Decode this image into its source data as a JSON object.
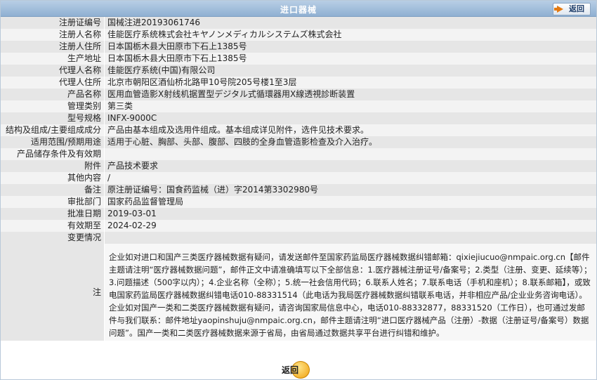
{
  "header": {
    "title": "进口器械",
    "back_label": "返回"
  },
  "rows": [
    {
      "label": "注册证编号",
      "value": "国械注进20193061746"
    },
    {
      "label": "注册人名称",
      "value": "佳能医疗系统株式会社キヤノンメディカルシステムズ株式会社"
    },
    {
      "label": "注册人住所",
      "value": "日本国栃木县大田原市下石上1385号"
    },
    {
      "label": "生产地址",
      "value": "日本国栃木县大田原市下石上1385号"
    },
    {
      "label": "代理人名称",
      "value": "佳能医疗系统(中国)有限公司"
    },
    {
      "label": "代理人住所",
      "value": "北京市朝阳区酒仙桥北路甲10号院205号楼1至3层"
    },
    {
      "label": "产品名称",
      "value": "医用血管造影X射线机据置型デジタル式循環器用X線透視診断装置"
    },
    {
      "label": "管理类别",
      "value": "第三类"
    },
    {
      "label": "型号规格",
      "value": "INFX-9000C"
    },
    {
      "label": "结构及组成/主要组成成分",
      "value": "产品由基本组成及选用件组成。基本组成详见附件，选件见技术要求。"
    },
    {
      "label": "适用范围/预期用途",
      "value": "适用于心脏、胸部、头部、腹部、四肢的全身血管造影检查及介入治疗。"
    },
    {
      "label": "产品储存条件及有效期",
      "value": ""
    },
    {
      "label": "附件",
      "value": "产品技术要求"
    },
    {
      "label": "其他内容",
      "value": "/"
    },
    {
      "label": "备注",
      "value": "原注册证编号：国食药监械（进）字2014第3302980号"
    },
    {
      "label": "审批部门",
      "value": "国家药品监督管理局"
    },
    {
      "label": "批准日期",
      "value": "2019-03-01"
    },
    {
      "label": "有效期至",
      "value": "2024-02-29"
    },
    {
      "label": "变更情况",
      "value": ""
    }
  ],
  "note": {
    "label": "注",
    "text": "企业如对进口和国产三类医疗器械数据有疑问，请发送邮件至国家药监局医疗器械数据纠错邮箱：qixiejiucuo@nmpaic.org.cn【邮件主题请注明“医疗器械数据问题”，邮件正文中请准确填写以下全部信息：1.医疗器械注册证号/备案号；2.类型（注册、变更、延续等）；3.问题描述（500字以内）；4.企业名称（全称）；5.统一社会信用代码；6.联系人姓名；7.联系电话（手机和座机）；8.联系邮箱】，或致电国家药监局医疗器械数据纠错电话010-88331514（此电话为我局医疗器械数据纠错联系电话，并非相应产品/企业业务咨询电话）。企业如对国产一类和二类医疗器械数据有疑问，请咨询国家局信息中心，电话010-88332877，88331520（工作日），也可通过发邮件与我们联系：邮件地址yaopinshuju@nmpaic.org.cn，邮件主题请注明“进口医疗器械产品（注册）-数据（注册证号/备案号）数据问题”。国产一类和二类医疗器械数据来源于省局，由省局通过数据共享平台进行纠错和维护。"
  },
  "footer": {
    "back_label": "返回"
  }
}
